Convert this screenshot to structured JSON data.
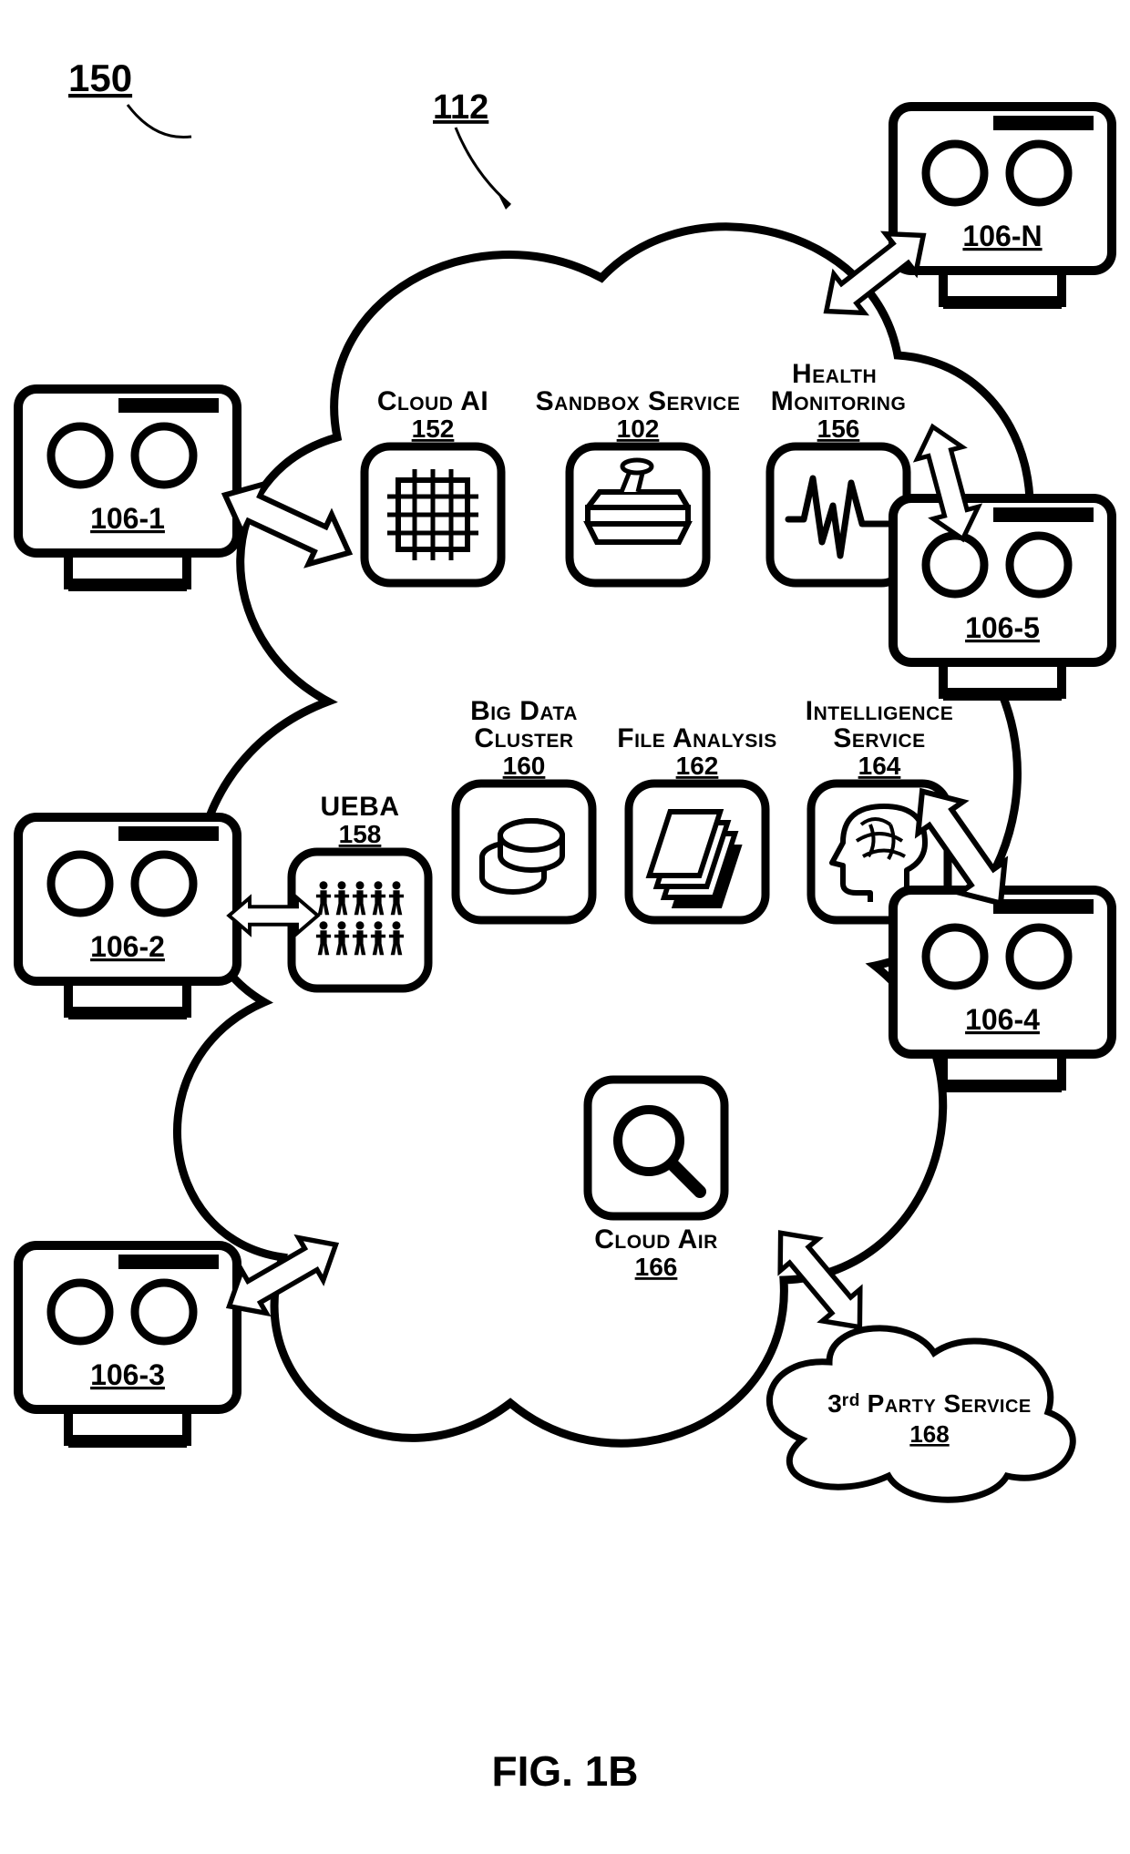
{
  "figure_label": "FIG. 1B",
  "diagram_ref": "150",
  "cloud_ref": "112",
  "cloud": {
    "services": {
      "top_row": [
        {
          "name": "Cloud AI",
          "ref": "152",
          "icon": "chip"
        },
        {
          "name": "Sandbox Service",
          "ref": "102",
          "icon": "sandbox"
        },
        {
          "name": "Health Monitoring",
          "ref": "156",
          "icon": "waveform"
        }
      ],
      "mid_row": [
        {
          "name": "UEBA",
          "ref": "158",
          "icon": "people"
        },
        {
          "name": "Big Data Cluster",
          "ref": "160",
          "icon": "discs"
        },
        {
          "name": "File Analysis",
          "ref": "162",
          "icon": "files"
        },
        {
          "name": "Intelligence Service",
          "ref": "164",
          "icon": "head"
        }
      ],
      "bottom_row": [
        {
          "name": "Cloud Air",
          "ref": "166",
          "icon": "magnifier"
        }
      ]
    }
  },
  "third_party": {
    "name": "3ʳᵈ Party Service",
    "ref": "168"
  },
  "nodes": {
    "left": [
      {
        "ref": "106-1"
      },
      {
        "ref": "106-2"
      },
      {
        "ref": "106-3"
      }
    ],
    "right": [
      {
        "ref": "106-N"
      },
      {
        "ref": "106-5"
      },
      {
        "ref": "106-4"
      }
    ]
  }
}
